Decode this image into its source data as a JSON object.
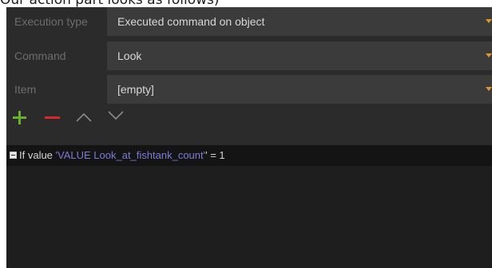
{
  "caption": "Our action part looks as follows)",
  "form": {
    "execution_type": {
      "label": "Execution type",
      "value": "Executed command on object"
    },
    "command": {
      "label": "Command",
      "value": "Look"
    },
    "item": {
      "label": "Item",
      "value": "[empty]"
    }
  },
  "toolbar": {
    "icons": [
      "add-icon",
      "remove-icon",
      "move-up-icon",
      "move-down-icon"
    ]
  },
  "tree": {
    "condition": {
      "prefix": "If value ",
      "variable": "'VALUE Look_at_fishtank_count'",
      "suffix": "' = 1"
    }
  },
  "colors": {
    "panel": "#2b2b2b",
    "field": "#3b3b3b",
    "dropdown_arrow": "#e0962b",
    "add_icon": "#6cae2f",
    "remove_icon": "#d8292a",
    "variable_text": "#7d7ad8"
  }
}
